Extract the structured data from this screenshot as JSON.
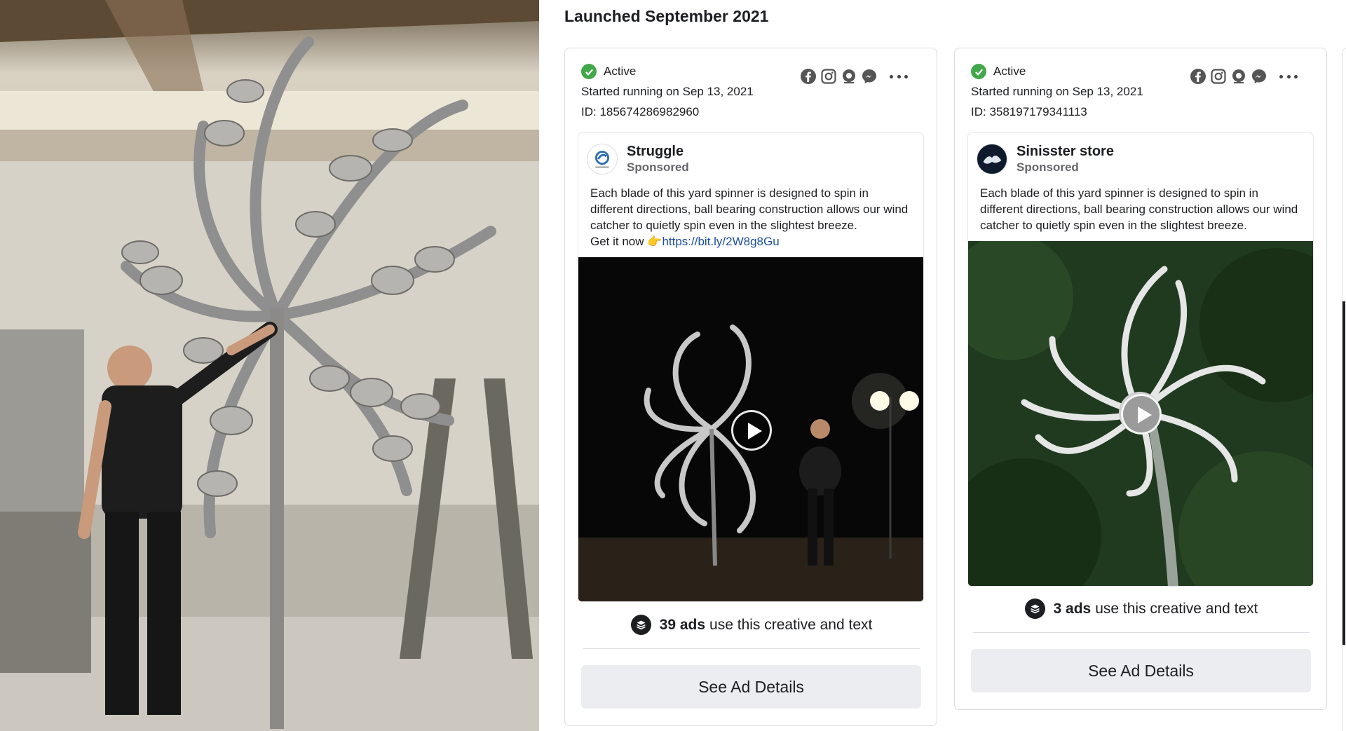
{
  "heading": "Launched September 2021",
  "cards": [
    {
      "status": "Active",
      "started": "Started running on Sep 13, 2021",
      "id": "ID: 185674286982960",
      "page_name": "Struggle",
      "sponsored": "Sponsored",
      "body_text": "Each blade of this yard spinner is designed to spin in different directions, ball bearing construction allows our wind catcher to quietly spin even in the slightest breeze.",
      "body_cta": "Get it now 👉",
      "body_link": "https://bit.ly/2W8g8Gu",
      "ads_count": "39 ads",
      "ads_count_suffix": "use this creative and text",
      "details_label": "See Ad Details"
    },
    {
      "status": "Active",
      "started": "Started running on Sep 13, 2021",
      "id": "ID: 358197179341113",
      "page_name": "Sinisster store",
      "sponsored": "Sponsored",
      "body_text": "Each blade of this yard spinner is designed to spin in different directions, ball bearing construction allows our wind catcher to quietly spin even in the slightest breeze.",
      "ads_count": "3 ads",
      "ads_count_suffix": "use this creative and text",
      "details_label": "See Ad Details"
    }
  ],
  "icons": {
    "status": "check-circle-icon",
    "platforms": [
      "facebook-icon",
      "instagram-icon",
      "audience-network-icon",
      "messenger-icon"
    ],
    "menu": "more-options-icon",
    "count": "stack-icon",
    "media": "play-icon"
  },
  "colors": {
    "active_green": "#42a84a",
    "link_blue": "#1b4f9c",
    "button_bg": "#ebedf0"
  }
}
